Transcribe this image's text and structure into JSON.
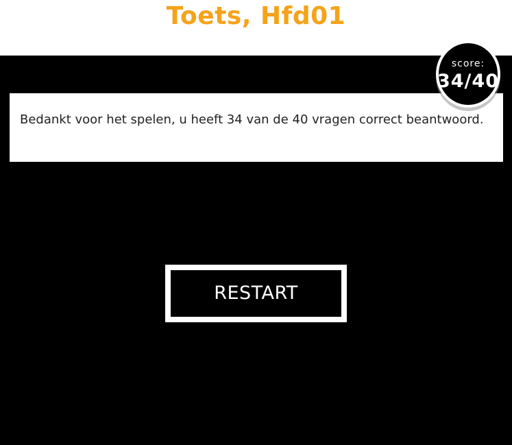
{
  "header": {
    "title": "Toets, Hfd01"
  },
  "score": {
    "label": "score:",
    "value": "34/40"
  },
  "result": {
    "message": "Bedankt voor het spelen, u heeft 34 van de 40 vragen correct beantwoord."
  },
  "actions": {
    "restart_label": "RESTART"
  },
  "colors": {
    "title": "#f5a31a",
    "stage_background": "#000000",
    "panel_background": "#ffffff",
    "text": "#222222"
  }
}
